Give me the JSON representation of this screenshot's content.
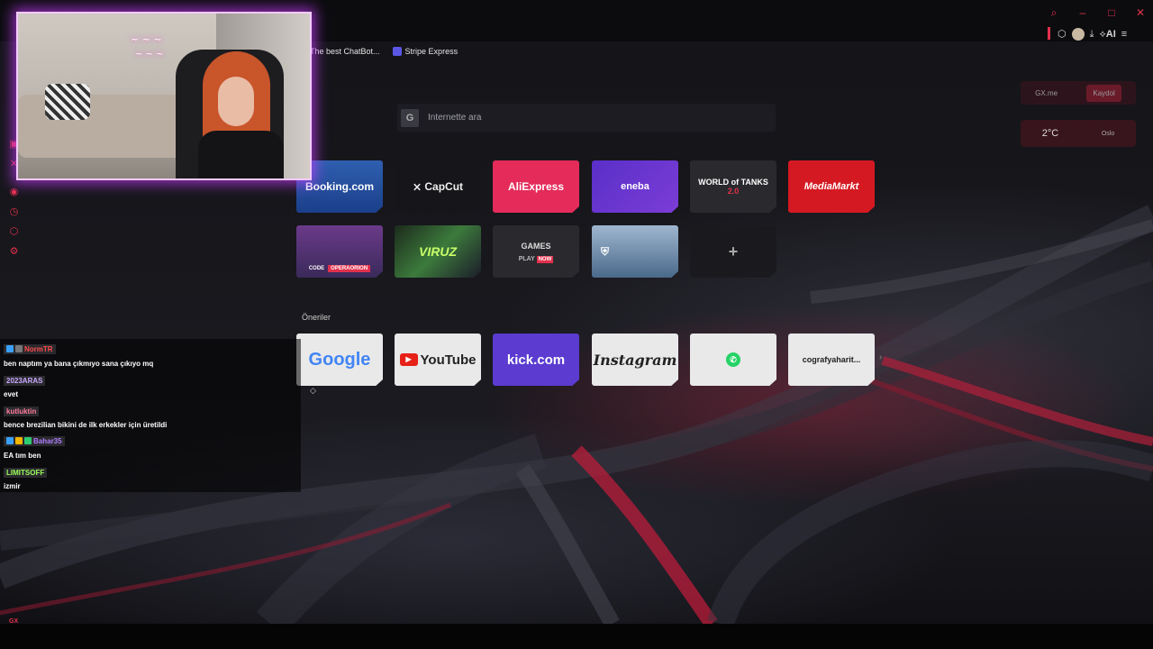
{
  "window": {
    "controls": [
      "search",
      "minimize",
      "maximize",
      "close"
    ]
  },
  "toolbar": {
    "ai_label": "AI"
  },
  "bookmarks": [
    {
      "label": "The best ChatBot..."
    },
    {
      "label": "Stripe Express"
    }
  ],
  "search": {
    "placeholder": "İnternette ara"
  },
  "widgets": {
    "gx_label": "GX.me",
    "signup_label": "Kaydol",
    "temperature": "2°C",
    "city": "Oslo"
  },
  "speed_dial": {
    "row1": [
      {
        "label": "Booking.com"
      },
      {
        "label": "CapCut"
      },
      {
        "label": "AliExpress"
      },
      {
        "label": "eneba"
      },
      {
        "label": "WORLD of TANKS",
        "sub": "2.0"
      },
      {
        "label": "MediaMarkt"
      }
    ],
    "row2": [
      {
        "code_label": "CODE",
        "code_value": "OPERAORION"
      },
      {
        "label": "VIRUZ"
      },
      {
        "label": "GAMES",
        "play": "PLAY",
        "now": "NOW"
      },
      {
        "label": "WoWS"
      },
      {
        "label": "+"
      }
    ]
  },
  "suggestions": {
    "title": "Öneriler",
    "items": [
      {
        "label": "Google"
      },
      {
        "label": "YouTube"
      },
      {
        "label": "kick.com"
      },
      {
        "label": "Instagram"
      },
      {
        "label": "WhatsApp"
      },
      {
        "label": "cografyaharit..."
      }
    ]
  },
  "chat": [
    {
      "user": "NormTR",
      "user_color": "#ff4a4a",
      "text": "ben naptım ya bana çıkmıyo sana çıkıyo mq"
    },
    {
      "user": "2023ARAS",
      "user_color": "#c9a8ff",
      "text": "evet"
    },
    {
      "user": "kutluktin",
      "user_color": "#ff7a9a",
      "text": "bence brezilian bikini de ilk erkekler için üretildi"
    },
    {
      "user": "Bahar35",
      "user_color": "#b07cff",
      "text": "EA tım ben"
    },
    {
      "user": "LIMITSOFF",
      "user_color": "#9cff5a",
      "text": "izmir"
    }
  ],
  "colors": {
    "accent": "#e1314c",
    "webcam_glow": "#c83cff"
  },
  "sidebar": {
    "gx_label": "GX",
    "more_label": "..."
  }
}
